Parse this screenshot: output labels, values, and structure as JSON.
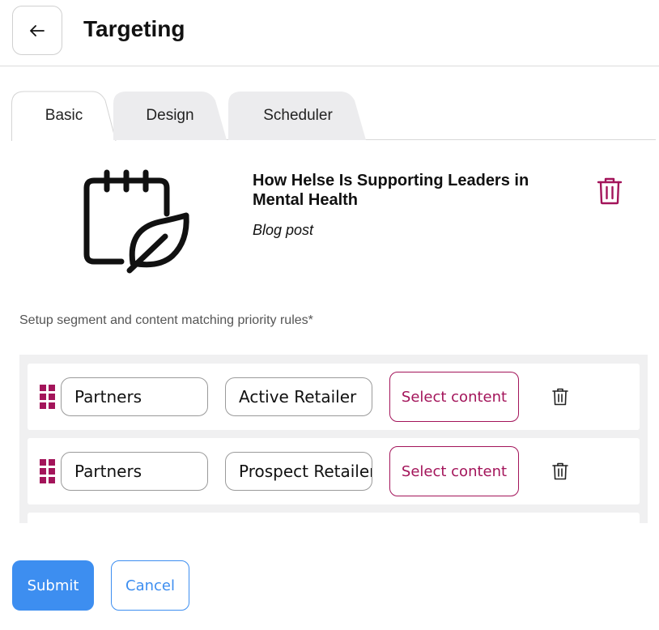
{
  "header": {
    "title": "Targeting",
    "back_icon": "arrow-left-icon"
  },
  "tabs": [
    {
      "label": "Basic",
      "active": true
    },
    {
      "label": "Design",
      "active": false
    },
    {
      "label": "Scheduler",
      "active": false
    }
  ],
  "content": {
    "title": "How Helse Is Supporting Leaders in Mental Health",
    "type": "Blog post",
    "icon": "calendar-feather-icon",
    "delete_icon": "trash-icon"
  },
  "rules": {
    "label": "Setup segment and content matching priority rules*",
    "rows": [
      {
        "segment": "Partners",
        "subsegment": "Active Retailer",
        "action": "Select content"
      },
      {
        "segment": "Partners",
        "subsegment": "Prospect Retailer",
        "action": "Select content"
      }
    ]
  },
  "actions": {
    "submit": "Submit",
    "cancel": "Cancel"
  },
  "colors": {
    "accent": "#a3145a",
    "primary": "#3d8ef0",
    "panel": "#f0f0f1"
  }
}
